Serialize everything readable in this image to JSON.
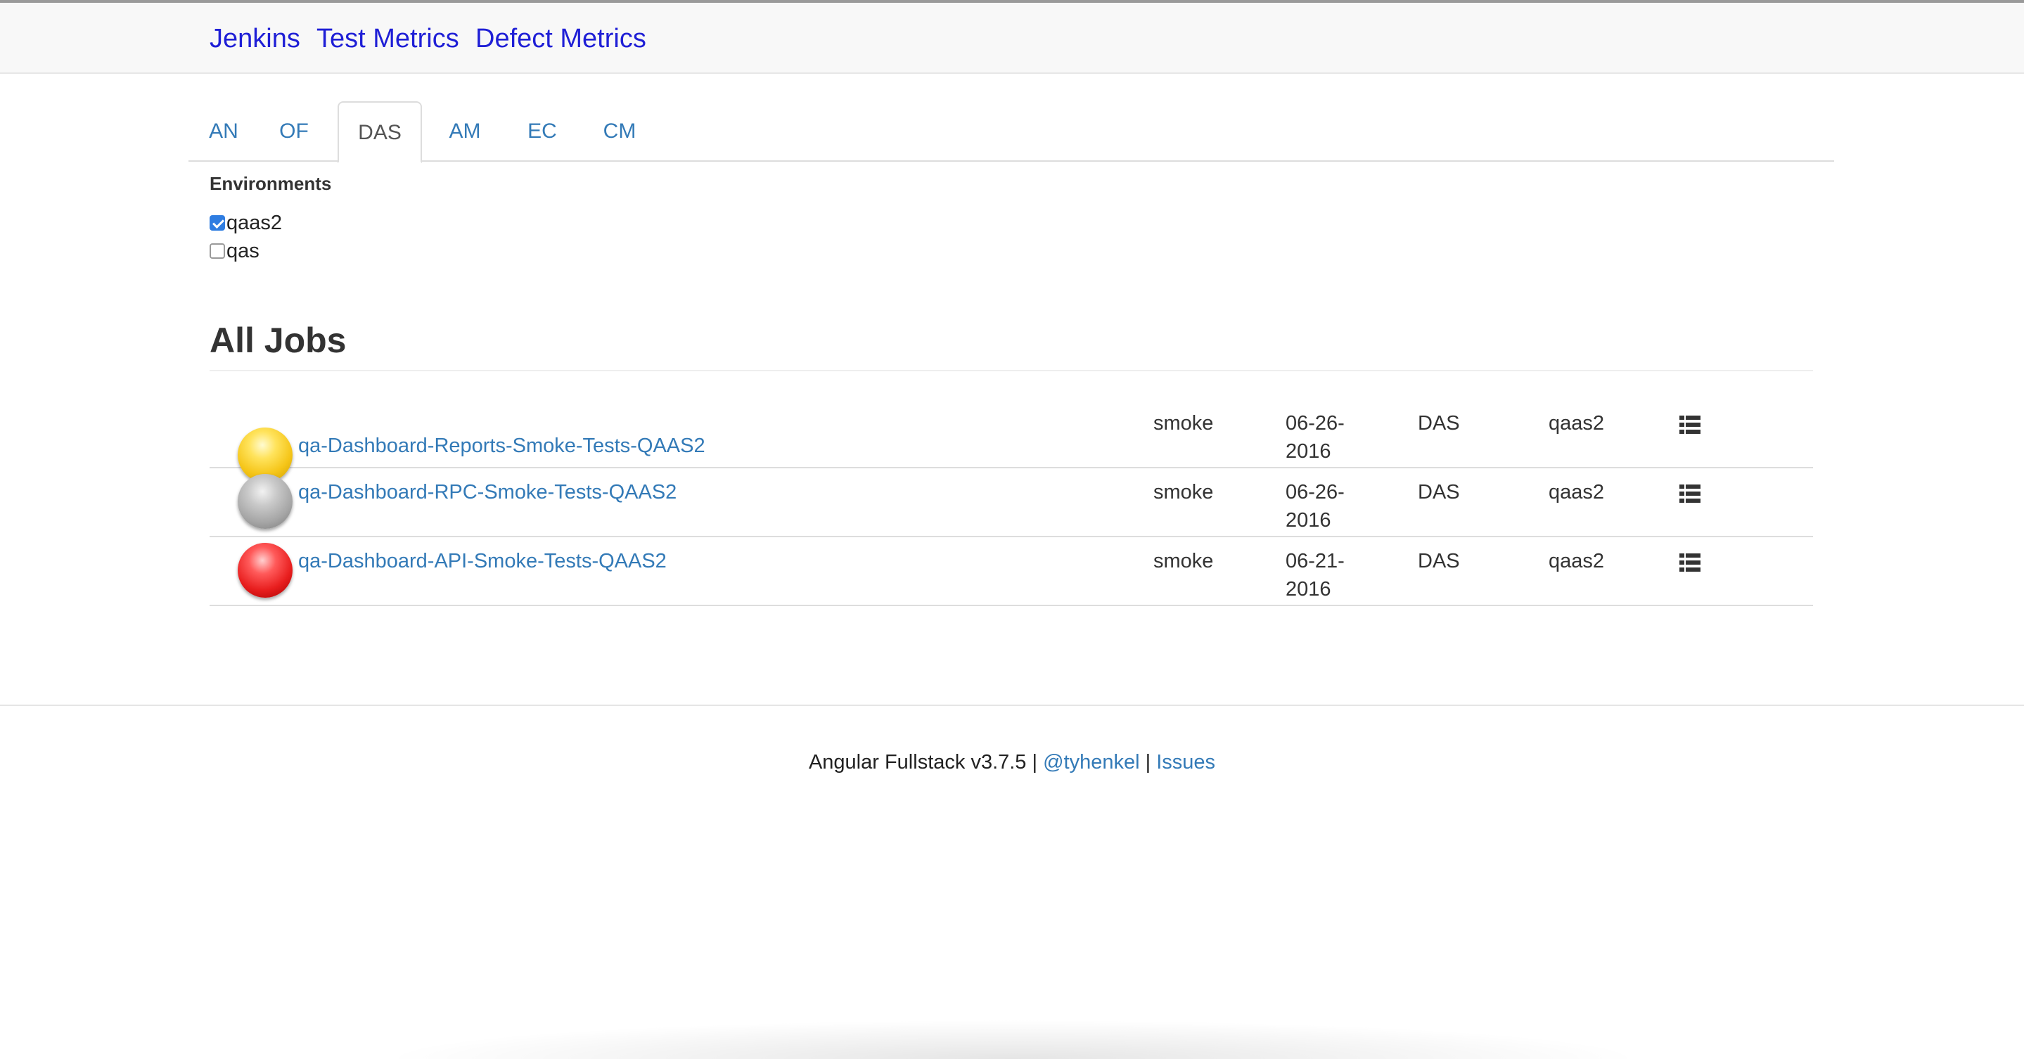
{
  "navbar": {
    "links": [
      "Jenkins",
      "Test Metrics",
      "Defect Metrics"
    ]
  },
  "tabs": {
    "items": [
      "AN",
      "OF",
      "DAS",
      "AM",
      "EC",
      "CM"
    ],
    "active": "DAS"
  },
  "environments": {
    "title": "Environments",
    "options": [
      {
        "label": "qaas2",
        "checked": true
      },
      {
        "label": "qas",
        "checked": false
      }
    ]
  },
  "jobs": {
    "title": "All Jobs",
    "rows": [
      {
        "status": "yellow",
        "name": "qa-Dashboard-Reports-Smoke-Tests-QAAS2",
        "type": "smoke",
        "date_line1": "06-26-",
        "date_line2": "2016",
        "app": "DAS",
        "env": "qaas2",
        "icon": "list-icon"
      },
      {
        "status": "grey",
        "name": "qa-Dashboard-RPC-Smoke-Tests-QAAS2",
        "type": "smoke",
        "date_line1": "06-26-",
        "date_line2": "2016",
        "app": "DAS",
        "env": "qaas2",
        "icon": "list-icon"
      },
      {
        "status": "red",
        "name": "qa-Dashboard-API-Smoke-Tests-QAAS2",
        "type": "smoke",
        "date_line1": "06-21-",
        "date_line2": "2016",
        "app": "DAS",
        "env": "qaas2",
        "icon": "list-icon"
      }
    ]
  },
  "footer": {
    "text": "Angular Fullstack v3.7.5 |",
    "separator": "|",
    "author_link": "@tyhenkel",
    "issues_link": "Issues"
  },
  "colors": {
    "link": "#337ab7",
    "nav_link": "#1f1fd6",
    "checkbox_checked": "#2f7de1"
  }
}
